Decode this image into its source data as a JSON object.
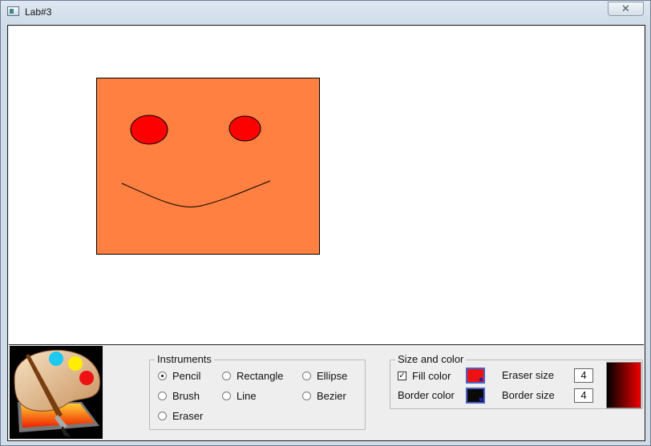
{
  "window": {
    "title": "Lab#3",
    "close_glyph": "✕"
  },
  "canvas": {
    "shapes": [
      {
        "kind": "rectangle",
        "name": "face-rectangle",
        "fill": "#ff8040",
        "stroke": "#000000"
      },
      {
        "kind": "ellipse",
        "name": "left-eye-ellipse",
        "fill": "#ff0000",
        "stroke": "#000000"
      },
      {
        "kind": "ellipse",
        "name": "right-eye-ellipse",
        "fill": "#ff0000",
        "stroke": "#000000"
      },
      {
        "kind": "bezier",
        "name": "smile-curve",
        "stroke": "#000000"
      }
    ]
  },
  "instruments": {
    "title": "Instruments",
    "options": [
      {
        "label": "Pencil",
        "checked": true
      },
      {
        "label": "Rectangle",
        "checked": false
      },
      {
        "label": "Ellipse",
        "checked": false
      },
      {
        "label": "Brush",
        "checked": false
      },
      {
        "label": "Line",
        "checked": false
      },
      {
        "label": "Bezier",
        "checked": false
      },
      {
        "label": "Eraser",
        "checked": false
      }
    ]
  },
  "size_color": {
    "title": "Size and color",
    "fill_color_label": "Fill color",
    "fill_checked": true,
    "fill_color": "#ee1111",
    "border_color_label": "Border color",
    "border_color": "#0a0a0a",
    "eraser_size_label": "Eraser size",
    "eraser_size": "4",
    "border_size_label": "Border size",
    "border_size": "4"
  },
  "colors": {
    "preview_start": "#000000",
    "preview_end": "#ee0000"
  }
}
